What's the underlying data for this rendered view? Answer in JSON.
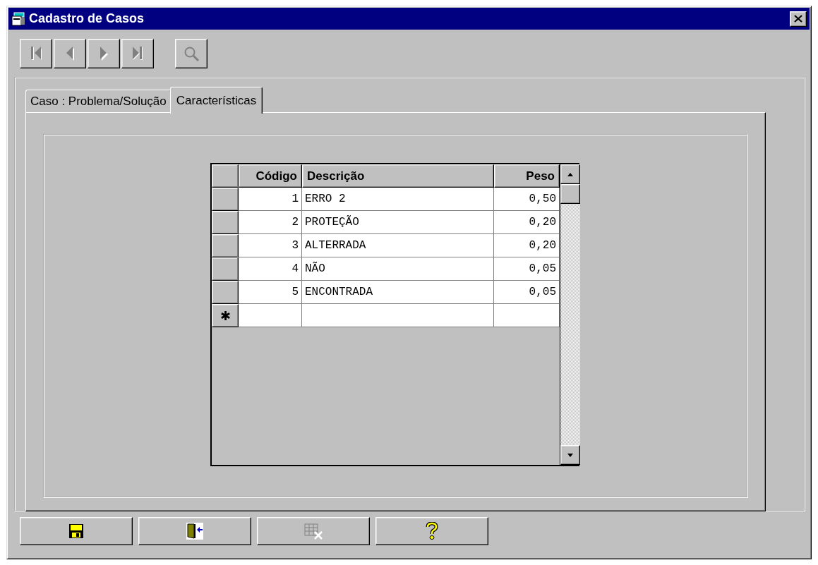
{
  "window": {
    "title": "Cadastro de Casos"
  },
  "toolbar": [
    {
      "kind": "first",
      "disabled": true
    },
    {
      "kind": "prev",
      "disabled": true
    },
    {
      "kind": "next",
      "disabled": true
    },
    {
      "kind": "last",
      "disabled": true
    },
    {
      "kind": "search",
      "disabled": true
    }
  ],
  "tabs": [
    {
      "label": "Caso : Problema/Solução",
      "selected": false
    },
    {
      "label": "Características",
      "selected": true
    }
  ],
  "table": {
    "columns": [
      "Código",
      "Descrição",
      "Peso"
    ],
    "rows": [
      {
        "cells": [
          "1",
          "ERRO 2",
          "0,50"
        ]
      },
      {
        "cells": [
          "2",
          "PROTEÇÃO",
          "0,20"
        ]
      },
      {
        "cells": [
          "3",
          "ALTERRADA",
          "0,20"
        ]
      },
      {
        "cells": [
          "4",
          "NÃO",
          "0,05"
        ]
      },
      {
        "cells": [
          "5",
          "ENCONTRADA",
          "0,05"
        ]
      }
    ],
    "new_row_marker": "✱"
  },
  "buttons": [
    {
      "kind": "save",
      "disabled": false
    },
    {
      "kind": "exit",
      "disabled": false
    },
    {
      "kind": "delete",
      "disabled": true
    },
    {
      "kind": "help",
      "disabled": false
    }
  ]
}
